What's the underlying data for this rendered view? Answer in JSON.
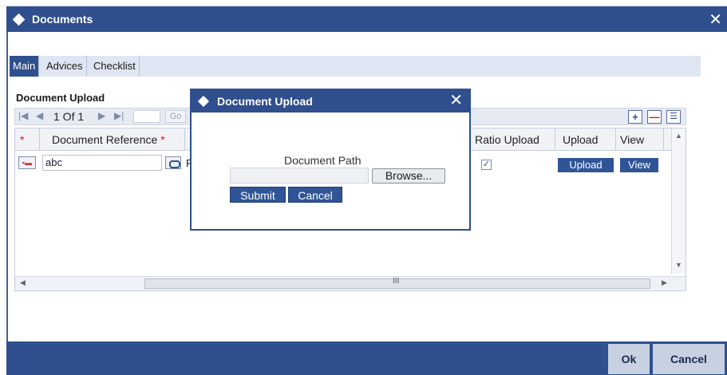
{
  "window": {
    "title": "Documents",
    "close_glyph": "✕"
  },
  "tabs": [
    {
      "label": "Main",
      "active": true
    },
    {
      "label": "Advices",
      "active": false
    },
    {
      "label": "Checklist",
      "active": false
    }
  ],
  "section": {
    "heading": "Document Upload"
  },
  "pager": {
    "first_glyph": "|◀",
    "prev_glyph": "◀",
    "page_text": "1 Of 1",
    "next_glyph": "▶",
    "last_glyph": "▶|",
    "go_label": "Go",
    "add_glyph": "+",
    "delete_glyph": "—",
    "view_glyph": "☰"
  },
  "grid": {
    "columns": {
      "required_marker": "*",
      "document_reference": "Document Reference",
      "ratio_upload": "Ratio Upload",
      "upload": "Upload",
      "view": "View"
    },
    "rows": [
      {
        "document_reference": "abc",
        "fragment": "F",
        "ratio_checked": true,
        "upload_label": "Upload",
        "view_label": "View"
      }
    ],
    "scroll_grip": "III"
  },
  "modal": {
    "title": "Document Upload",
    "close_glyph": "✕",
    "doc_path_label": "Document Path",
    "doc_path_value": "",
    "browse_label": "Browse...",
    "submit_label": "Submit",
    "cancel_label": "Cancel"
  },
  "footer": {
    "ok_label": "Ok",
    "cancel_label": "Cancel"
  },
  "colors": {
    "brand_blue": "#2f4f8e",
    "button_blue": "#2f5596",
    "required_red": "#dd1111"
  }
}
